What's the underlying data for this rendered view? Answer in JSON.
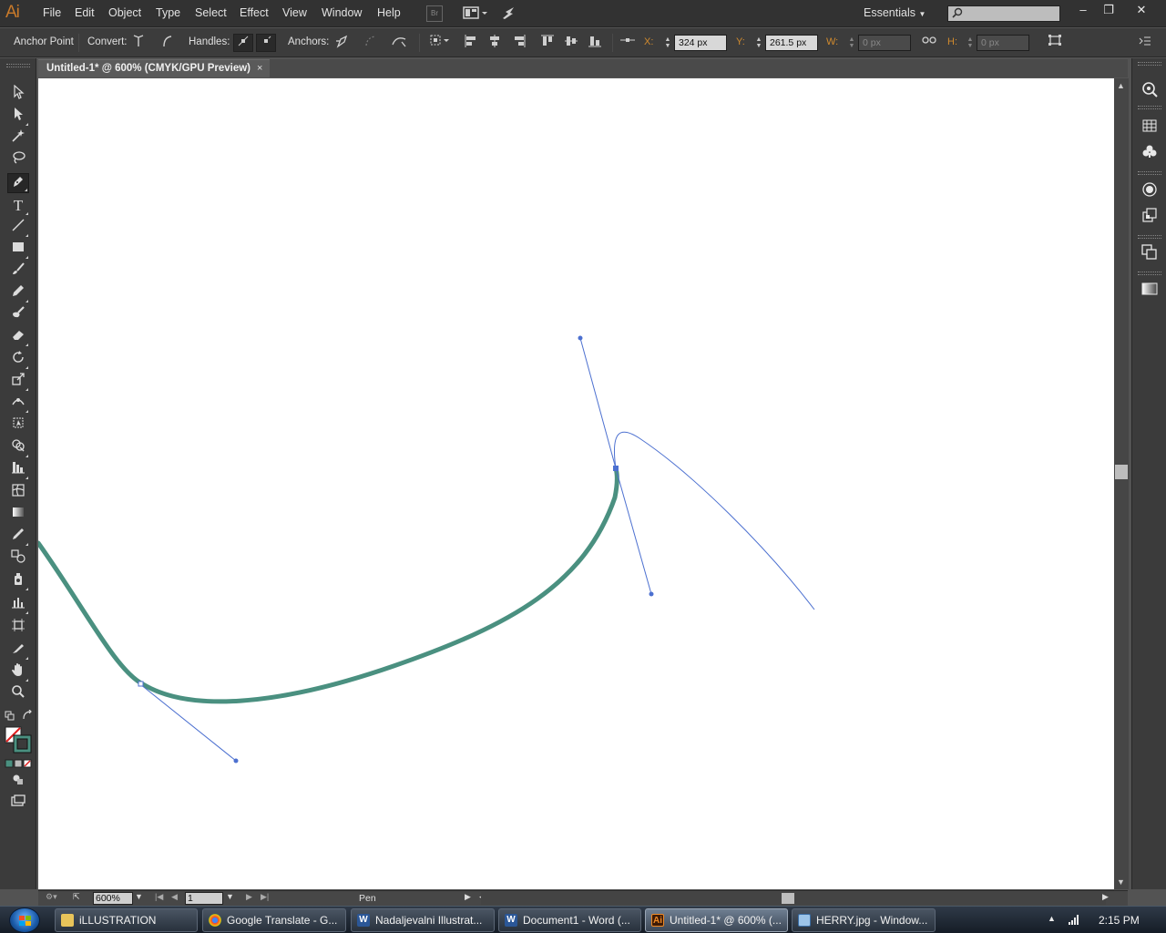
{
  "app": {
    "logo": "Ai",
    "menus": [
      "File",
      "Edit",
      "Object",
      "Type",
      "Select",
      "Effect",
      "View",
      "Window",
      "Help"
    ],
    "bridge_label": "Br",
    "workspace": "Essentials",
    "search_placeholder": ""
  },
  "control_bar": {
    "anchor_point_label": "Anchor Point",
    "convert_label": "Convert:",
    "handles_label": "Handles:",
    "anchors_label": "Anchors:",
    "x_label": "X:",
    "x_value": "324 px",
    "y_label": "Y:",
    "y_value": "261.5 px",
    "w_label": "W:",
    "w_value": "0 px",
    "h_label": "H:",
    "h_value": "0 px"
  },
  "document": {
    "tab_title": "Untitled-1* @ 600% (CMYK/GPU Preview)",
    "close_glyph": "×"
  },
  "canvas": {
    "stroke_color": "#4a9080",
    "path_color": "#4c70d0"
  },
  "status_bar": {
    "zoom": "600%",
    "artboard": "1",
    "current_tool": "Pen"
  },
  "taskbar": {
    "items": [
      {
        "label": "iLLUSTRATION",
        "icon": "folder-icon"
      },
      {
        "label": "Google Translate - G...",
        "icon": "chrome-icon"
      },
      {
        "label": "Nadaljevalni Illustrat...",
        "icon": "word-icon"
      },
      {
        "label": "Document1 - Word (...",
        "icon": "word-icon"
      },
      {
        "label": "Untitled-1* @ 600% (...",
        "icon": "illustrator-icon"
      },
      {
        "label": "HERRY.jpg - Window...",
        "icon": "photo-viewer-icon"
      }
    ],
    "time": "2:15 PM"
  }
}
